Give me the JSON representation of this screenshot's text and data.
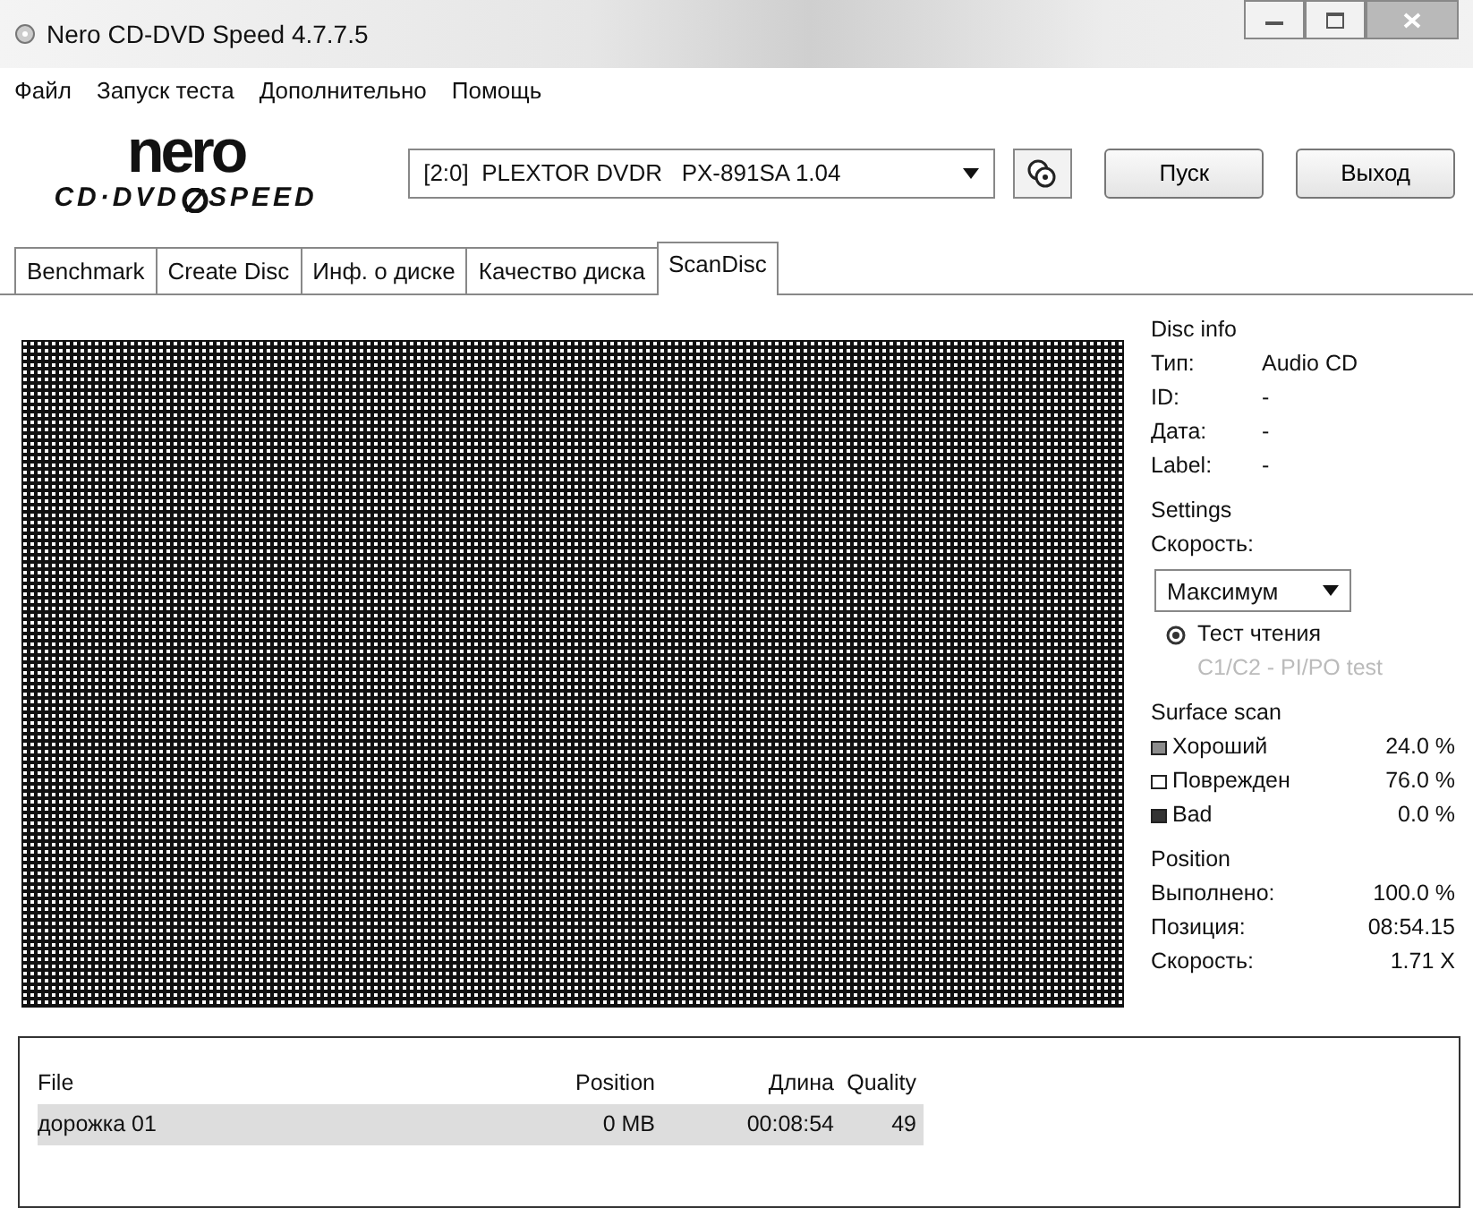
{
  "window": {
    "title": "Nero CD-DVD Speed 4.7.7.5"
  },
  "menu": [
    "Файл",
    "Запуск теста",
    "Дополнительно",
    "Помощь"
  ],
  "logo": {
    "brand": "nero",
    "line_left": "CD·DVD",
    "line_right": "SPEED"
  },
  "drive": {
    "value": "[2:0]  PLEXTOR DVDR   PX-891SA 1.04"
  },
  "buttons": [
    "Пуск",
    "Выход"
  ],
  "tabs": [
    {
      "label": "Benchmark",
      "selected": false
    },
    {
      "label": "Create Disc",
      "selected": false
    },
    {
      "label": "Инф. о диске",
      "selected": false
    },
    {
      "label": "Качество диска",
      "selected": false
    },
    {
      "label": "ScanDisc",
      "selected": true
    }
  ],
  "disc_info": {
    "heading": "Disc info",
    "rows": [
      {
        "label": "Тип:",
        "value": "Audio CD"
      },
      {
        "label": "ID:",
        "value": "-"
      },
      {
        "label": "Дата:",
        "value": "-"
      },
      {
        "label": "Label:",
        "value": "-"
      }
    ]
  },
  "settings": {
    "heading": "Settings",
    "speed_label": "Скорость:",
    "speed_value": "Максимум",
    "options": [
      {
        "label": "Тест чтения",
        "selected": true,
        "disabled": false
      },
      {
        "label": "C1/C2 - PI/PO test",
        "selected": false,
        "disabled": true
      }
    ]
  },
  "surface_scan": {
    "heading": "Surface scan",
    "items": [
      {
        "label": "Хороший",
        "value": "24.0 %",
        "color": "#8c8c8c"
      },
      {
        "label": "Поврежден",
        "value": "76.0 %",
        "color": "#ffffff"
      },
      {
        "label": "Bad",
        "value": "0.0 %",
        "color": "#333333"
      }
    ]
  },
  "position": {
    "heading": "Position",
    "rows": [
      {
        "label": "Выполнено:",
        "value": "100.0 %"
      },
      {
        "label": "Позиция:",
        "value": "08:54.15"
      },
      {
        "label": "Скорость:",
        "value": "1.71 X"
      }
    ]
  },
  "table": {
    "columns": [
      "File",
      "Position",
      "Длина",
      "Quality"
    ],
    "rows": [
      {
        "cells": [
          "дорожка 01",
          "0 MB",
          "00:08:54",
          "49"
        ],
        "selected": true
      }
    ]
  }
}
